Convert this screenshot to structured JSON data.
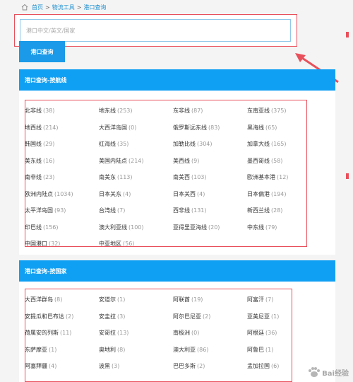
{
  "breadcrumb": {
    "home": "首页",
    "sep1": ">",
    "crumb1": "物流工具",
    "sep2": ">",
    "crumb2": "港口查询"
  },
  "search": {
    "placeholder": "港口中文/英文/国家",
    "button_label": "港口查询"
  },
  "routes": {
    "header": "港口查询-按航线",
    "items": [
      {
        "name": "北非线",
        "count": "(38)"
      },
      {
        "name": "地东线",
        "count": "(253)"
      },
      {
        "name": "东非线",
        "count": "(87)"
      },
      {
        "name": "东南亚线",
        "count": "(375)"
      },
      {
        "name": "地西线",
        "count": "(214)"
      },
      {
        "name": "大西洋岛国",
        "count": "(0)"
      },
      {
        "name": "俄罗斯远东线",
        "count": "(83)"
      },
      {
        "name": "黑海线",
        "count": "(65)"
      },
      {
        "name": "韩国线",
        "count": "(29)"
      },
      {
        "name": "红海线",
        "count": "(35)"
      },
      {
        "name": "加勒比线",
        "count": "(304)"
      },
      {
        "name": "加拿大线",
        "count": "(165)"
      },
      {
        "name": "美东线",
        "count": "(16)"
      },
      {
        "name": "美国内陆点",
        "count": "(214)"
      },
      {
        "name": "美西线",
        "count": "(9)"
      },
      {
        "name": "墨西哥线",
        "count": "(58)"
      },
      {
        "name": "南非线",
        "count": "(23)"
      },
      {
        "name": "南美东",
        "count": "(113)"
      },
      {
        "name": "南美西",
        "count": "(103)"
      },
      {
        "name": "欧洲基本港",
        "count": "(12)"
      },
      {
        "name": "欧洲内陆点",
        "count": "(1034)"
      },
      {
        "name": "日本关东",
        "count": "(4)"
      },
      {
        "name": "日本关西",
        "count": "(4)"
      },
      {
        "name": "日本偏港",
        "count": "(194)"
      },
      {
        "name": "太平洋岛国",
        "count": "(93)"
      },
      {
        "name": "台湾线",
        "count": "(7)"
      },
      {
        "name": "西非线",
        "count": "(131)"
      },
      {
        "name": "新西兰线",
        "count": "(28)"
      },
      {
        "name": "印巴线",
        "count": "(156)"
      },
      {
        "name": "澳大利亚线",
        "count": "(100)"
      },
      {
        "name": "亚得里亚海线",
        "count": "(20)"
      },
      {
        "name": "中东线",
        "count": "(79)"
      },
      {
        "name": "中国港口",
        "count": "(32)"
      },
      {
        "name": "中亚地区",
        "count": "(56)"
      }
    ]
  },
  "countries": {
    "header": "港口查询-按国家",
    "items": [
      {
        "name": "大西洋群岛",
        "count": "(8)"
      },
      {
        "name": "安道尔",
        "count": "(1)"
      },
      {
        "name": "阿联酋",
        "count": "(19)"
      },
      {
        "name": "阿富汗",
        "count": "(7)"
      },
      {
        "name": "安提瓜和巴布达",
        "count": "(2)"
      },
      {
        "name": "安圭拉",
        "count": "(3)"
      },
      {
        "name": "阿尔巴尼亚",
        "count": "(2)"
      },
      {
        "name": "亚美尼亚",
        "count": "(1)"
      },
      {
        "name": "荷属安的列斯",
        "count": "(11)"
      },
      {
        "name": "安哥拉",
        "count": "(13)"
      },
      {
        "name": "南极洲",
        "count": "(0)"
      },
      {
        "name": "阿根廷",
        "count": "(36)"
      },
      {
        "name": "东萨摩亚",
        "count": "(1)"
      },
      {
        "name": "奥地利",
        "count": "(8)"
      },
      {
        "name": "澳大利亚",
        "count": "(86)"
      },
      {
        "name": "阿鲁巴",
        "count": "(1)"
      },
      {
        "name": "阿塞拜疆",
        "count": "(4)"
      },
      {
        "name": "波黑",
        "count": "(3)"
      },
      {
        "name": "巴巴多斯",
        "count": "(2)"
      },
      {
        "name": "孟加拉国",
        "count": "(6)"
      }
    ]
  },
  "watermark": {
    "text": "Bai经验"
  },
  "colors": {
    "accent": "#10a0f3",
    "highlight": "#e8505b",
    "link": "#1a8fd0"
  }
}
